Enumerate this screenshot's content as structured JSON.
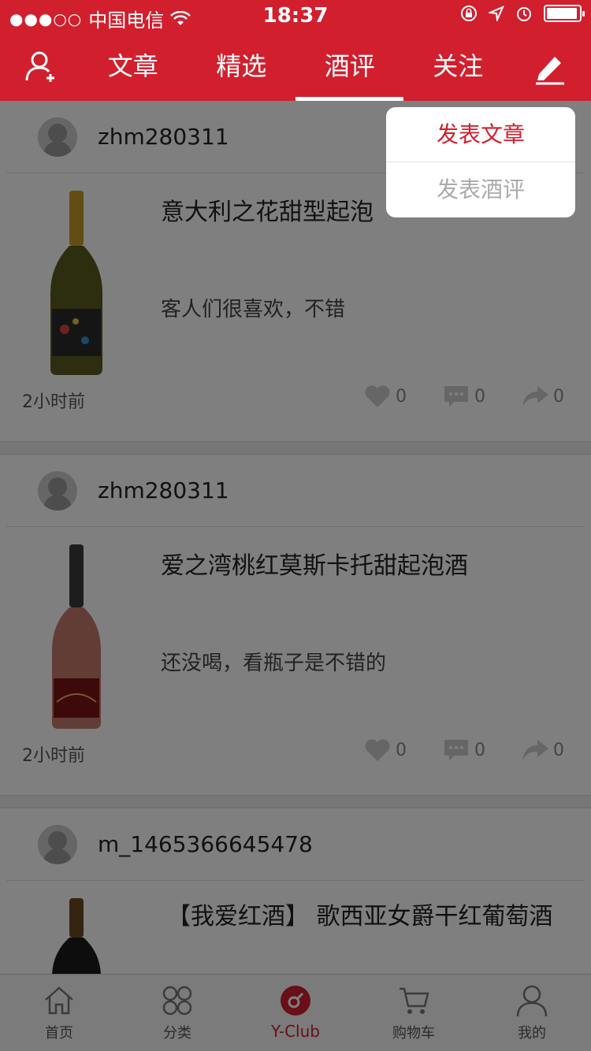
{
  "status_bar": {
    "carrier": "中国电信",
    "time": "18:37",
    "signal": "●●●○○",
    "battery_level": 0.95
  },
  "nav": {
    "tabs": [
      {
        "label": "文章"
      },
      {
        "label": "精选"
      },
      {
        "label": "酒评"
      },
      {
        "label": "关注"
      }
    ],
    "active_tab": "酒评"
  },
  "dropdown": {
    "items": [
      {
        "label": "发表文章"
      },
      {
        "label": "发表酒评"
      }
    ]
  },
  "feed": [
    {
      "username": "zhm280311",
      "title": "意大利之花甜型起泡",
      "comment": "客人们很喜欢，不错",
      "time": "2小时前",
      "likes": "0",
      "comments": "0",
      "shares": "0",
      "bottle": {
        "body": "#5b5a1f",
        "neck": "#c79a2a",
        "label": "#2b2b2b"
      }
    },
    {
      "username": "zhm280311",
      "title": "爱之湾桃红莫斯卡托甜起泡酒",
      "comment": "还没喝，看瓶子是不错的",
      "time": "2小时前",
      "likes": "0",
      "comments": "0",
      "shares": "0",
      "bottle": {
        "body": "#c47a6a",
        "neck": "#3a3a3a",
        "label": "#7a1418"
      }
    },
    {
      "username": "m_1465366645478",
      "title": "【我爱红酒】 歌西亚女爵干红葡萄酒",
      "bottle": {
        "body": "#1a1a1a",
        "neck": "#6b4a20",
        "label": "#eeeeee"
      }
    }
  ],
  "tabbar": {
    "items": [
      {
        "label": "首页",
        "icon": "home-icon"
      },
      {
        "label": "分类",
        "icon": "category-icon"
      },
      {
        "label": "Y-Club",
        "icon": "yclub-icon"
      },
      {
        "label": "购物车",
        "icon": "cart-icon"
      },
      {
        "label": "我的",
        "icon": "profile-icon"
      }
    ],
    "active": "Y-Club"
  },
  "colors": {
    "brand_red": "#d11f2e",
    "overlay": "rgba(0,0,0,0.5)"
  }
}
